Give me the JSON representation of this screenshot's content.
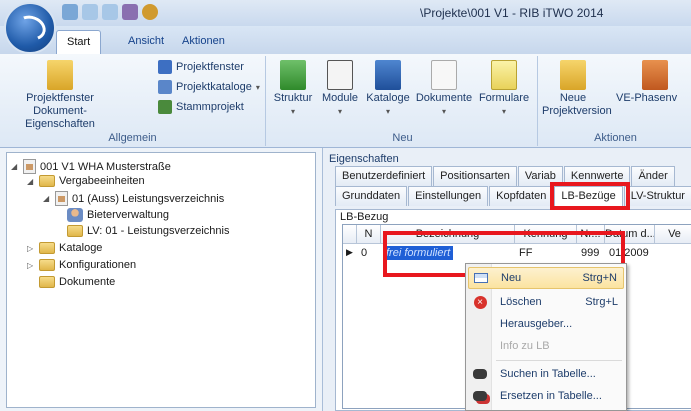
{
  "window": {
    "title": "\\Projekte\\001 V1 - RIB iTWO 2014"
  },
  "ribbon_tabs": [
    "Start",
    "Ansicht",
    "Aktionen"
  ],
  "ribbon": {
    "groups": {
      "allgemein": "Allgemein",
      "neu": "Neu",
      "aktionen": "Aktionen"
    },
    "buttons": {
      "projektfenster_dok": "Projektfenster Dokument-Eigenschaften",
      "projektfenster": "Projektfenster",
      "projektkataloge": "Projektkataloge",
      "stammprojekt": "Stammprojekt",
      "struktur": "Struktur",
      "module": "Module",
      "kataloge": "Kataloge",
      "dokumente": "Dokumente",
      "formulare": "Formulare",
      "neue_projektversion": "Neue Projektversion",
      "ve_phasen": "VE-Phasenv"
    }
  },
  "tree": [
    {
      "label": "001 V1 WHA Musterstraße"
    },
    {
      "label": "Vergabeeinheiten"
    },
    {
      "label": "01 (Auss) Leistungsverzeichnis"
    },
    {
      "label": "Bieterverwaltung"
    },
    {
      "label": "LV: 01 - Leistungsverzeichnis"
    },
    {
      "label": "Kataloge"
    },
    {
      "label": "Konfigurationen"
    },
    {
      "label": "Dokumente"
    }
  ],
  "properties": {
    "label": "Eigenschaften",
    "tabs_row1": [
      "Benutzerdefiniert",
      "Positionsarten",
      "Variab",
      "Kennwerte",
      "Änder"
    ],
    "tabs_row2": [
      "Grunddaten",
      "Einstellungen",
      "Kopfdaten",
      "LB-Bezüge",
      "LV-Struktur"
    ],
    "active_tab": "LB-Bezüge",
    "panel_label": "LB-Bezug",
    "columns": [
      "N",
      "Bezeichnung",
      "Kennung",
      "Nr...",
      "Datum d...",
      "Ve"
    ],
    "row": {
      "marker": "▶",
      "n": "0",
      "bezeichnung": "frei formuliert",
      "kennung": "FF",
      "nr": "999",
      "datum": "01.2009"
    }
  },
  "context_menu": {
    "items": [
      {
        "label": "Neu",
        "shortcut": "Strg+N",
        "icon": "new-row-icon",
        "state": "hover"
      },
      {
        "label": "Löschen",
        "shortcut": "Strg+L",
        "icon": "delete-icon",
        "state": "normal"
      },
      {
        "label": "Herausgeber...",
        "shortcut": "",
        "icon": "",
        "state": "normal"
      },
      {
        "label": "Info zu LB",
        "shortcut": "",
        "icon": "",
        "state": "disabled"
      },
      {
        "label": "Suchen in Tabelle...",
        "shortcut": "",
        "icon": "binoculars-icon",
        "state": "normal"
      },
      {
        "label": "Ersetzen in Tabelle...",
        "shortcut": "",
        "icon": "replace-binoculars-icon",
        "state": "normal"
      }
    ]
  },
  "colors": {
    "highlight_red": "#e8171e",
    "selection_blue": "#1f5fd6",
    "menu_hover": "#fbe3a0"
  }
}
